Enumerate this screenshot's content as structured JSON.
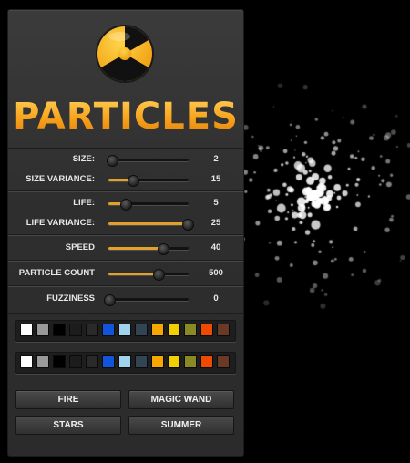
{
  "title": "PARTICLES",
  "sliders": [
    {
      "id": "size",
      "label": "SIZE:",
      "value": "2",
      "fraction": 0.03,
      "filled": false
    },
    {
      "id": "size-variance",
      "label": "SIZE VARIANCE:",
      "value": "15",
      "fraction": 0.3,
      "filled": true
    },
    {
      "id": "life",
      "label": "LIFE:",
      "value": "5",
      "fraction": 0.2,
      "filled": true
    },
    {
      "id": "life-variance",
      "label": "LIFE VARIANCE:",
      "value": "25",
      "fraction": 0.98,
      "filled": true
    },
    {
      "id": "speed",
      "label": "SPEED",
      "value": "40",
      "fraction": 0.67,
      "filled": true
    },
    {
      "id": "particle-count",
      "label": "PARTICLE COUNT",
      "value": "500",
      "fraction": 0.61,
      "filled": true
    },
    {
      "id": "fuzziness",
      "label": "FUZZINESS",
      "value": "0",
      "fraction": 0.0,
      "filled": false
    }
  ],
  "palettes": [
    {
      "name": "start-color-palette",
      "colors": [
        "#ffffff",
        "#9a9a9a",
        "#000000",
        "#1c1c1c",
        "#2a2a2a",
        "#1155dd",
        "#9fd3ee",
        "#334455",
        "#f7a800",
        "#f2d000",
        "#8a8a24",
        "#ee4a00",
        "#6a3a26"
      ]
    },
    {
      "name": "end-color-palette",
      "colors": [
        "#ffffff",
        "#9a9a9a",
        "#000000",
        "#1c1c1c",
        "#2a2a2a",
        "#1155dd",
        "#9fd3ee",
        "#334455",
        "#f7a800",
        "#f2d000",
        "#8a8a24",
        "#ee4a00",
        "#6a3a26"
      ]
    }
  ],
  "presets": {
    "fire": "FIRE",
    "magic_wand": "MAGIC WAND",
    "stars": "STARS",
    "summer": "SUMMER"
  },
  "logo_icon": "radiation-icon",
  "accent_color": "#f29a17"
}
